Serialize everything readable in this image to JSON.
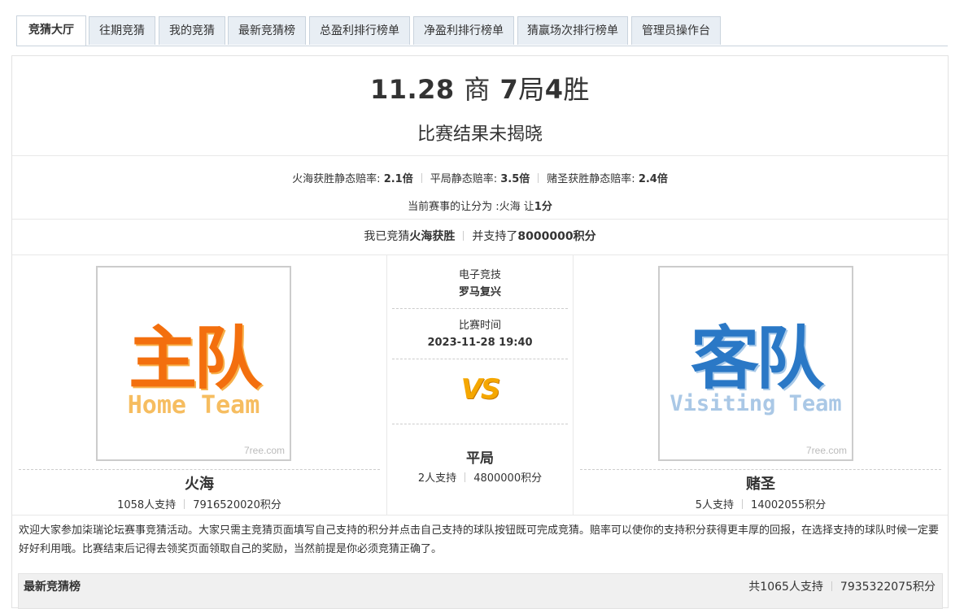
{
  "tabs": [
    {
      "label": "竞猜大厅",
      "active": true
    },
    {
      "label": "往期竞猜"
    },
    {
      "label": "我的竞猜"
    },
    {
      "label": "最新竞猜榜"
    },
    {
      "label": "总盈利排行榜单"
    },
    {
      "label": "净盈利排行榜单"
    },
    {
      "label": "猜赢场次排行榜单"
    },
    {
      "label": "管理员操作台"
    }
  ],
  "match": {
    "title_date": "11.28",
    "title_cn1": "商",
    "title_num": "7",
    "title_cn2": "局",
    "title_num2": "4",
    "title_cn3": "胜",
    "result_status": "比赛结果未揭晓"
  },
  "odds": {
    "home_label": "火海获胜静态赔率:",
    "home_value": "2.1倍",
    "draw_label": "平局静态赔率:",
    "draw_value": "3.5倍",
    "away_label": "赌圣获胜静态赔率:",
    "away_value": "2.4倍",
    "handicap_label": "当前赛事的让分为 :火海 让",
    "handicap_value": "1分"
  },
  "my_bet": {
    "prefix": "我已竞猜",
    "choice": "火海获胜",
    "mid": "并支持了",
    "points": "8000000积分"
  },
  "home": {
    "logo_big": "主队",
    "logo_sub": "Home Team",
    "watermark": "7ree.com",
    "name": "火海",
    "supporters": "1058人支持",
    "points": "7916520020积分"
  },
  "away": {
    "logo_big": "客队",
    "logo_sub": "Visiting Team",
    "watermark": "7ree.com",
    "name": "赌圣",
    "supporters": "5人支持",
    "points": "14002055积分"
  },
  "middle": {
    "category_label": "电子竞技",
    "category_value": "罗马复兴",
    "time_label": "比赛时间",
    "time_value": "2023-11-28 19:40",
    "vs": "VS",
    "draw_label": "平局",
    "draw_supporters": "2人支持",
    "draw_points": "4800000积分"
  },
  "intro_text": "欢迎大家参加柒瑞论坛赛事竞猜活动。大家只需主竞猜页面填写自己支持的积分并点击自己支持的球队按钮既可完成竞猜。赔率可以使你的支持积分获得更丰厚的回报，在选择支持的球队时候一定要好好利用哦。比赛结束后记得去领奖页面领取自己的奖励，当然前提是你必须竞猜正确了。",
  "board": {
    "title": "最新竞猜榜",
    "total_supporters": "共1065人支持",
    "total_points": "7935322075积分"
  }
}
